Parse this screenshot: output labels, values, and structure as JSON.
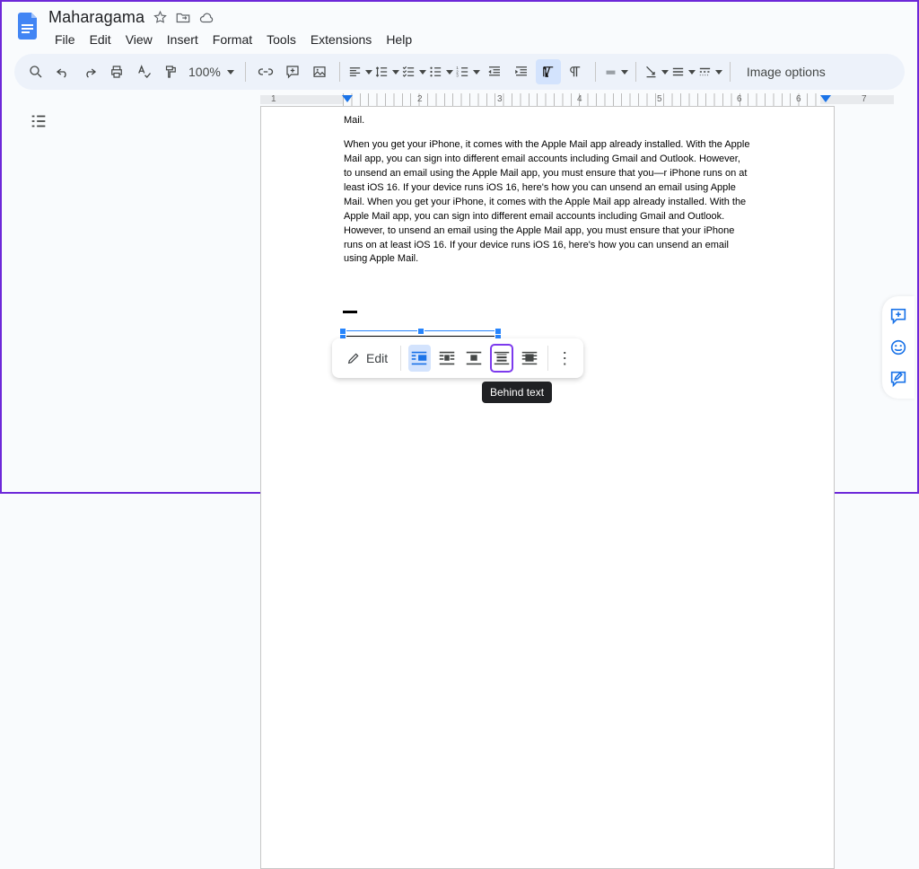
{
  "doc": {
    "name": "Maharagama"
  },
  "menus": [
    "File",
    "Edit",
    "View",
    "Insert",
    "Format",
    "Tools",
    "Extensions",
    "Help"
  ],
  "toolbar": {
    "zoom": "100%",
    "image_options": "Image options"
  },
  "doc_body": {
    "line_pre": "Mail.",
    "para": "When you get your iPhone, it comes with the Apple Mail app already installed. With the Apple Mail app, you can sign into different email accounts including Gmail and Outlook. However, to unsend an email using the Apple Mail app, you must ensure that you—r iPhone runs on at least iOS 16. If your device runs iOS 16, here's how you can unsend an email using Apple Mail. When you get your iPhone, it comes with the Apple Mail app already installed. With the Apple Mail app, you can sign into different email accounts including Gmail and Outlook. However, to unsend an email using the Apple Mail app, you must ensure that your iPhone runs on at least iOS 16. If your device runs iOS 16, here's how you can unsend an email using Apple Mail."
  },
  "float": {
    "edit": "Edit",
    "tooltip": "Behind text"
  },
  "ruler_numbers": [
    "1",
    "2",
    "3",
    "4",
    "5",
    "6",
    "7"
  ]
}
